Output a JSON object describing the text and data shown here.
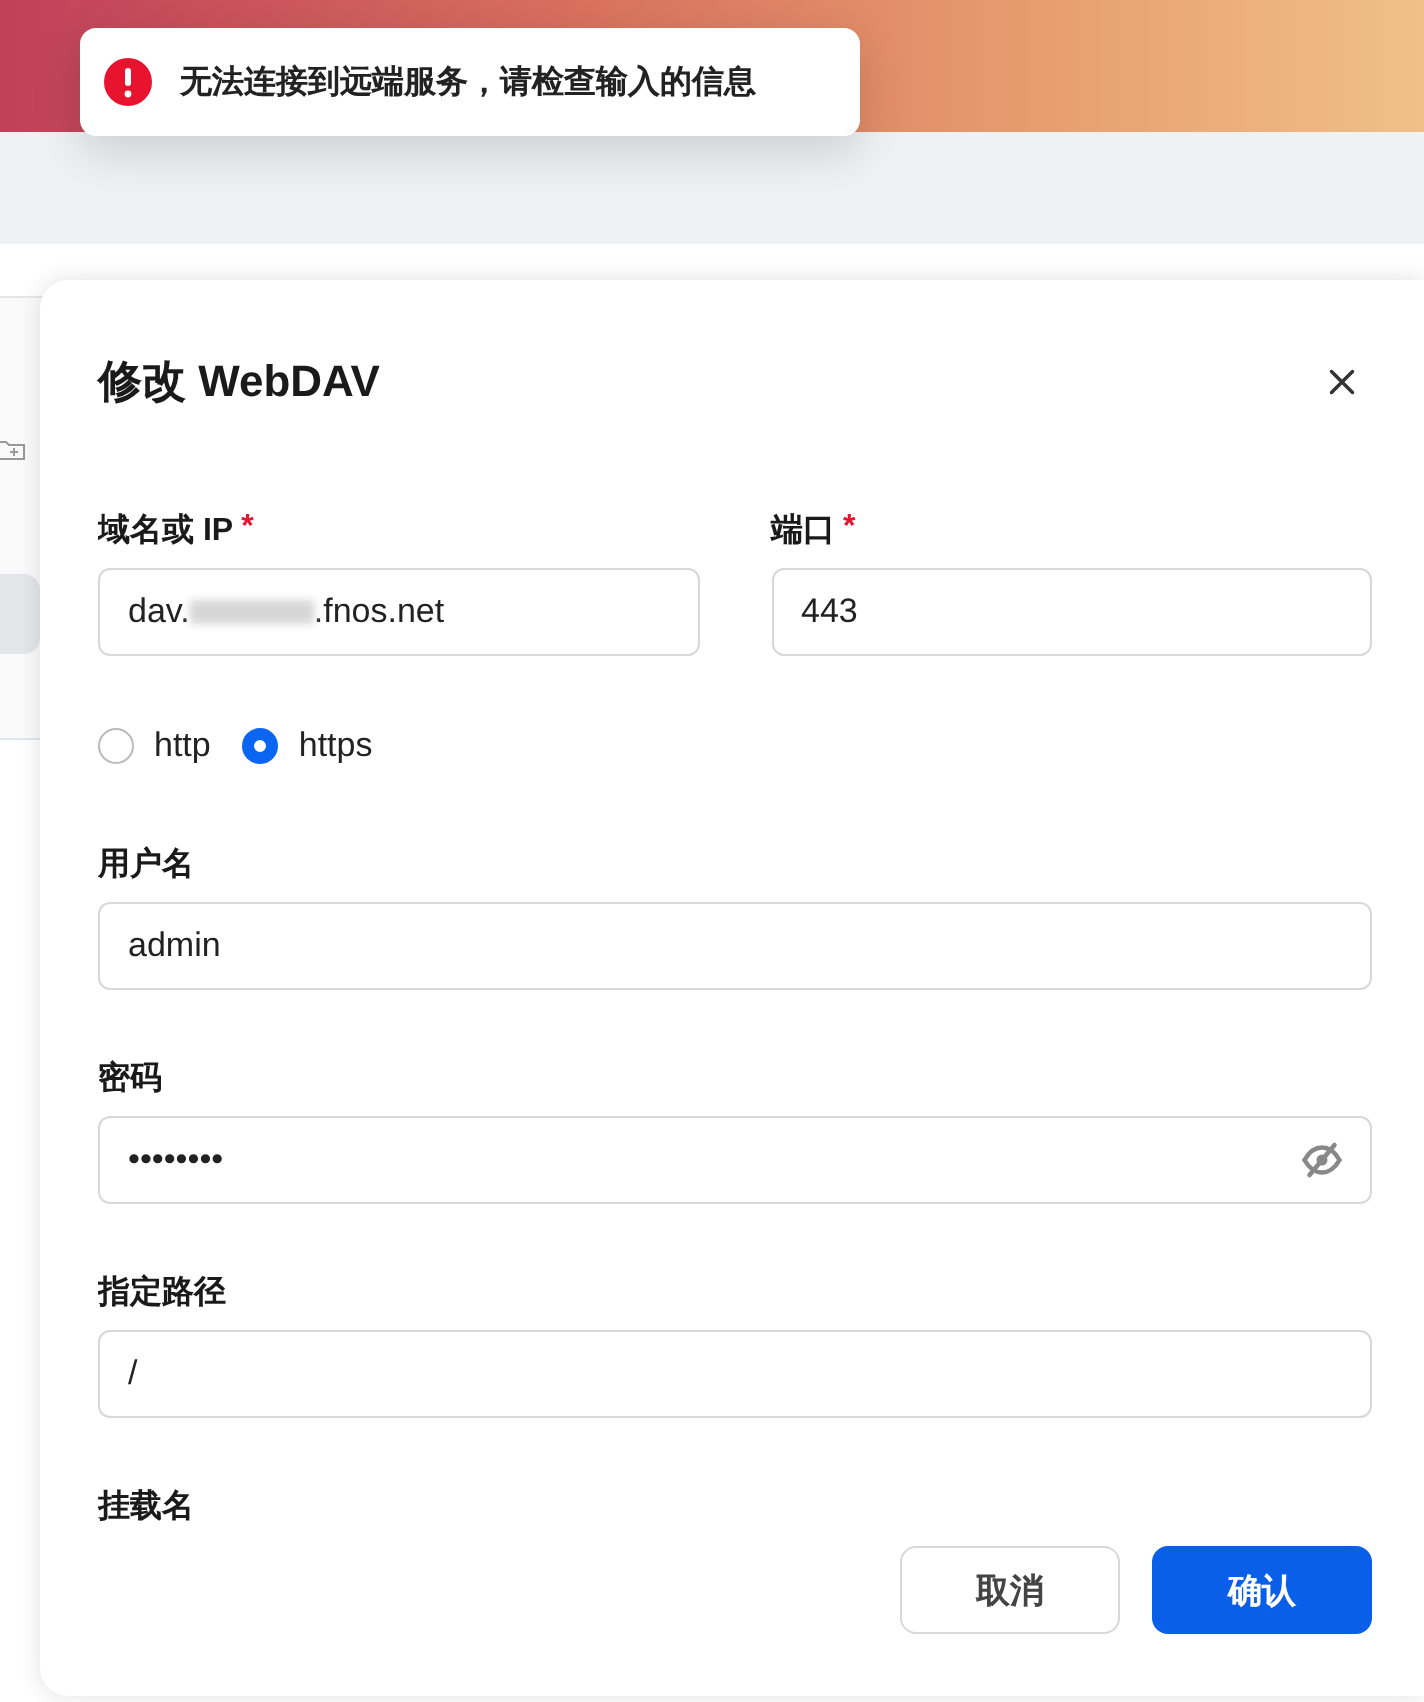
{
  "toast": {
    "kind": "error",
    "message": "无法连接到远端服务，请检查输入的信息"
  },
  "dialog": {
    "title": "修改 WebDAV",
    "items": [
      {
        "kind": "row",
        "fields": [
          {
            "label": "域名或 IP",
            "required_mark": "*",
            "value_parts": [
              "dav.",
              ".fnos.net"
            ],
            "redacted": true
          },
          {
            "label": "端口",
            "required_mark": "*",
            "value_parts": [
              "443"
            ]
          }
        ]
      },
      {
        "kind": "radio",
        "options": [
          {
            "label": "http",
            "selected": false
          },
          {
            "label": "https",
            "selected": true
          }
        ]
      },
      {
        "kind": "text",
        "label": "用户名",
        "value": "admin"
      },
      {
        "kind": "password",
        "label": "密码",
        "value": "••••••••"
      },
      {
        "kind": "text",
        "label": "指定路径",
        "value": "/"
      },
      {
        "kind": "label",
        "label": "挂载名"
      }
    ],
    "buttons": [
      {
        "label": "取消",
        "kind": "secondary"
      },
      {
        "label": "确认",
        "kind": "primary"
      }
    ]
  }
}
